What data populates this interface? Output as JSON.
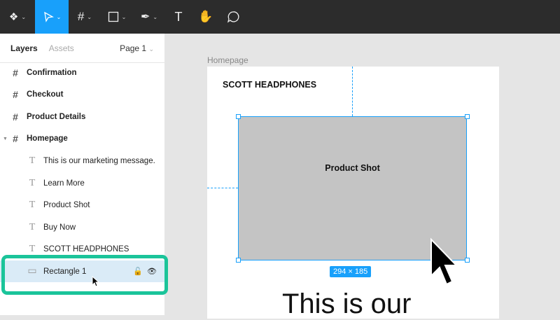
{
  "toolbar": {
    "tools": [
      "figma-menu",
      "move",
      "frame",
      "shape",
      "pen",
      "text",
      "hand",
      "comment"
    ]
  },
  "panel": {
    "tab_layers": "Layers",
    "tab_assets": "Assets",
    "page": "Page 1",
    "layers": [
      {
        "label": "Confirmation",
        "type": "frame"
      },
      {
        "label": "Checkout",
        "type": "frame"
      },
      {
        "label": "Product Details",
        "type": "frame"
      },
      {
        "label": "Homepage",
        "type": "frame"
      },
      {
        "label": "This is our marketing message.",
        "type": "text"
      },
      {
        "label": "Learn More",
        "type": "text"
      },
      {
        "label": "Product Shot",
        "type": "text"
      },
      {
        "label": "Buy Now",
        "type": "text"
      },
      {
        "label": "SCOTT HEADPHONES",
        "type": "text"
      },
      {
        "label": "Rectangle 1",
        "type": "rectangle",
        "selected": true
      }
    ]
  },
  "canvas": {
    "frame_label": "Homepage",
    "brand": "SCOTT HEADPHONES",
    "rect_text": "Product Shot",
    "dimensions": "294 × 185",
    "headline": "This is our"
  },
  "colors": {
    "accent": "#18a0fb",
    "highlight": "#1bc49a"
  }
}
